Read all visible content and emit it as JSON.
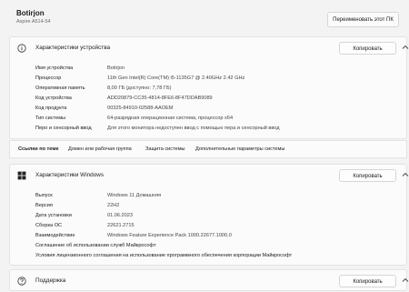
{
  "header": {
    "device_name": "Botirjon",
    "device_model": "Aspire A514-54",
    "rename_button": "Переименовать этот ПК"
  },
  "device_specs": {
    "title": "Характеристики устройства",
    "copy_button": "Копировать",
    "rows": [
      {
        "label": "Имя устройства",
        "value": "Botirjon"
      },
      {
        "label": "Процессор",
        "value": "11th Gen Intel(R) Core(TM) i5-1135G7 @ 2.40GHz   2.42 GHz"
      },
      {
        "label": "Оперативная память",
        "value": "8,00 ГБ (доступно: 7,78 ГБ)"
      },
      {
        "label": "Код устройства",
        "value": "ADD20879-CC35-4814-8FE6-8F47DDAB9089"
      },
      {
        "label": "Код продукта",
        "value": "00325-84910-02588-AAOEM"
      },
      {
        "label": "Тип системы",
        "value": "64-разрядная операционная система, процессор x64"
      },
      {
        "label": "Перо и сенсорный ввод",
        "value": "Для этого монитора недоступен ввод с помощью пера и сенсорный ввод"
      }
    ]
  },
  "related_links": {
    "title": "Ссылки по теме",
    "links": [
      "Домен или рабочая группа",
      "Защита системы",
      "Дополнительные параметры системы"
    ]
  },
  "windows_specs": {
    "title": "Характеристики Windows",
    "copy_button": "Копировать",
    "rows": [
      {
        "label": "Выпуск",
        "value": "Windows 11 Домашняя"
      },
      {
        "label": "Версия",
        "value": "22H2"
      },
      {
        "label": "Дата установки",
        "value": "01.06.2023"
      },
      {
        "label": "Сборка ОС",
        "value": "22621.2715"
      },
      {
        "label": "Взаимодействие",
        "value": "Windows Feature Experience Pack 1000.22677.1000.0"
      }
    ],
    "links": [
      "Соглашение об использовании служб Майкрософт",
      "Условия лицензионного соглашения на использование программного обеспечения корпорации Майкрософт"
    ]
  },
  "support": {
    "title": "Поддержка",
    "copy_button": "Копировать"
  }
}
